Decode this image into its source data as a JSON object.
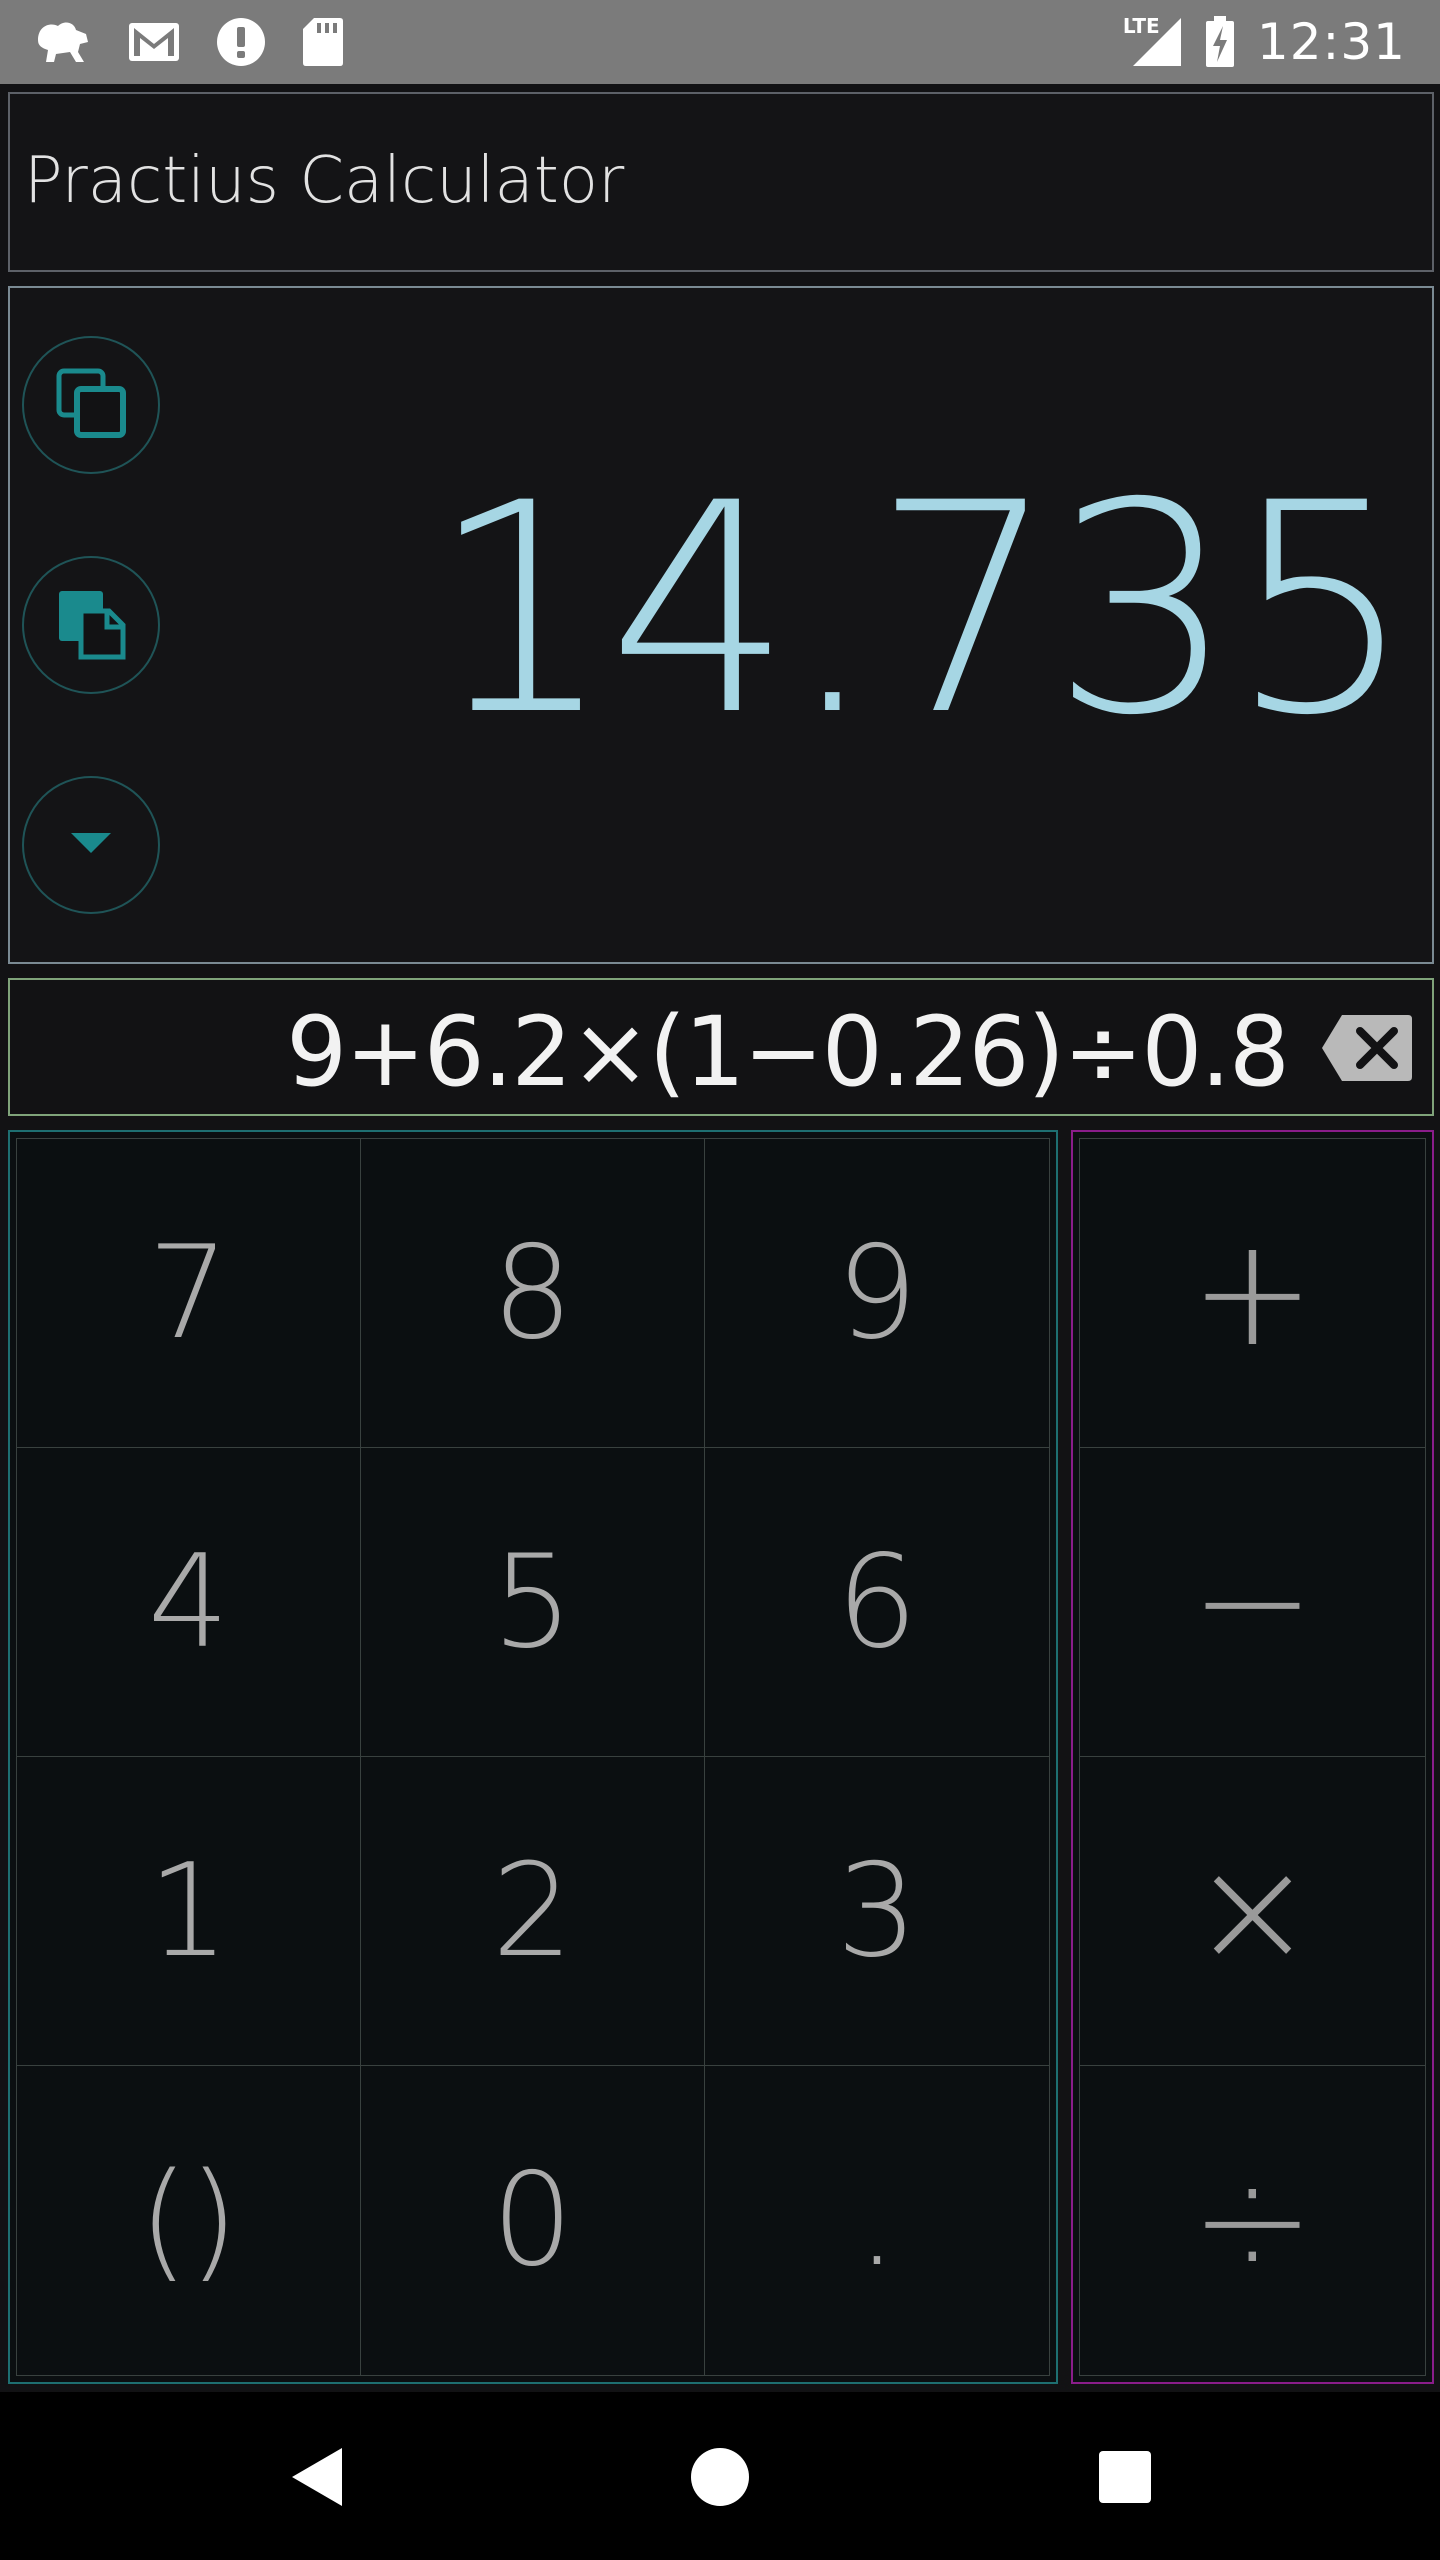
{
  "status_bar": {
    "time": "12:31",
    "network_label": "LTE",
    "icons": [
      "lion-icon",
      "gmail-icon",
      "alert-icon",
      "sd-card-icon",
      "lte-signal-icon",
      "battery-charging-icon"
    ]
  },
  "app_bar": {
    "title": "Practius Calculator"
  },
  "result": {
    "value": "14.735"
  },
  "result_actions": [
    "copy-icon",
    "paste-icon",
    "dropdown-icon"
  ],
  "expression": {
    "text": "9+6.2×(1−0.26)÷0.8"
  },
  "keypad": {
    "digits": [
      "7",
      "8",
      "9",
      "4",
      "5",
      "6",
      "1",
      "2",
      "3",
      "()",
      "0",
      "."
    ],
    "operators": [
      "+",
      "−",
      "×",
      "÷"
    ]
  },
  "colors": {
    "result_text": "#a6d6e4",
    "accent": "#1a8a8d",
    "digits_border": "#1e6f71",
    "ops_border": "#8a1d8a",
    "status_bar": "#7b7b7b"
  }
}
